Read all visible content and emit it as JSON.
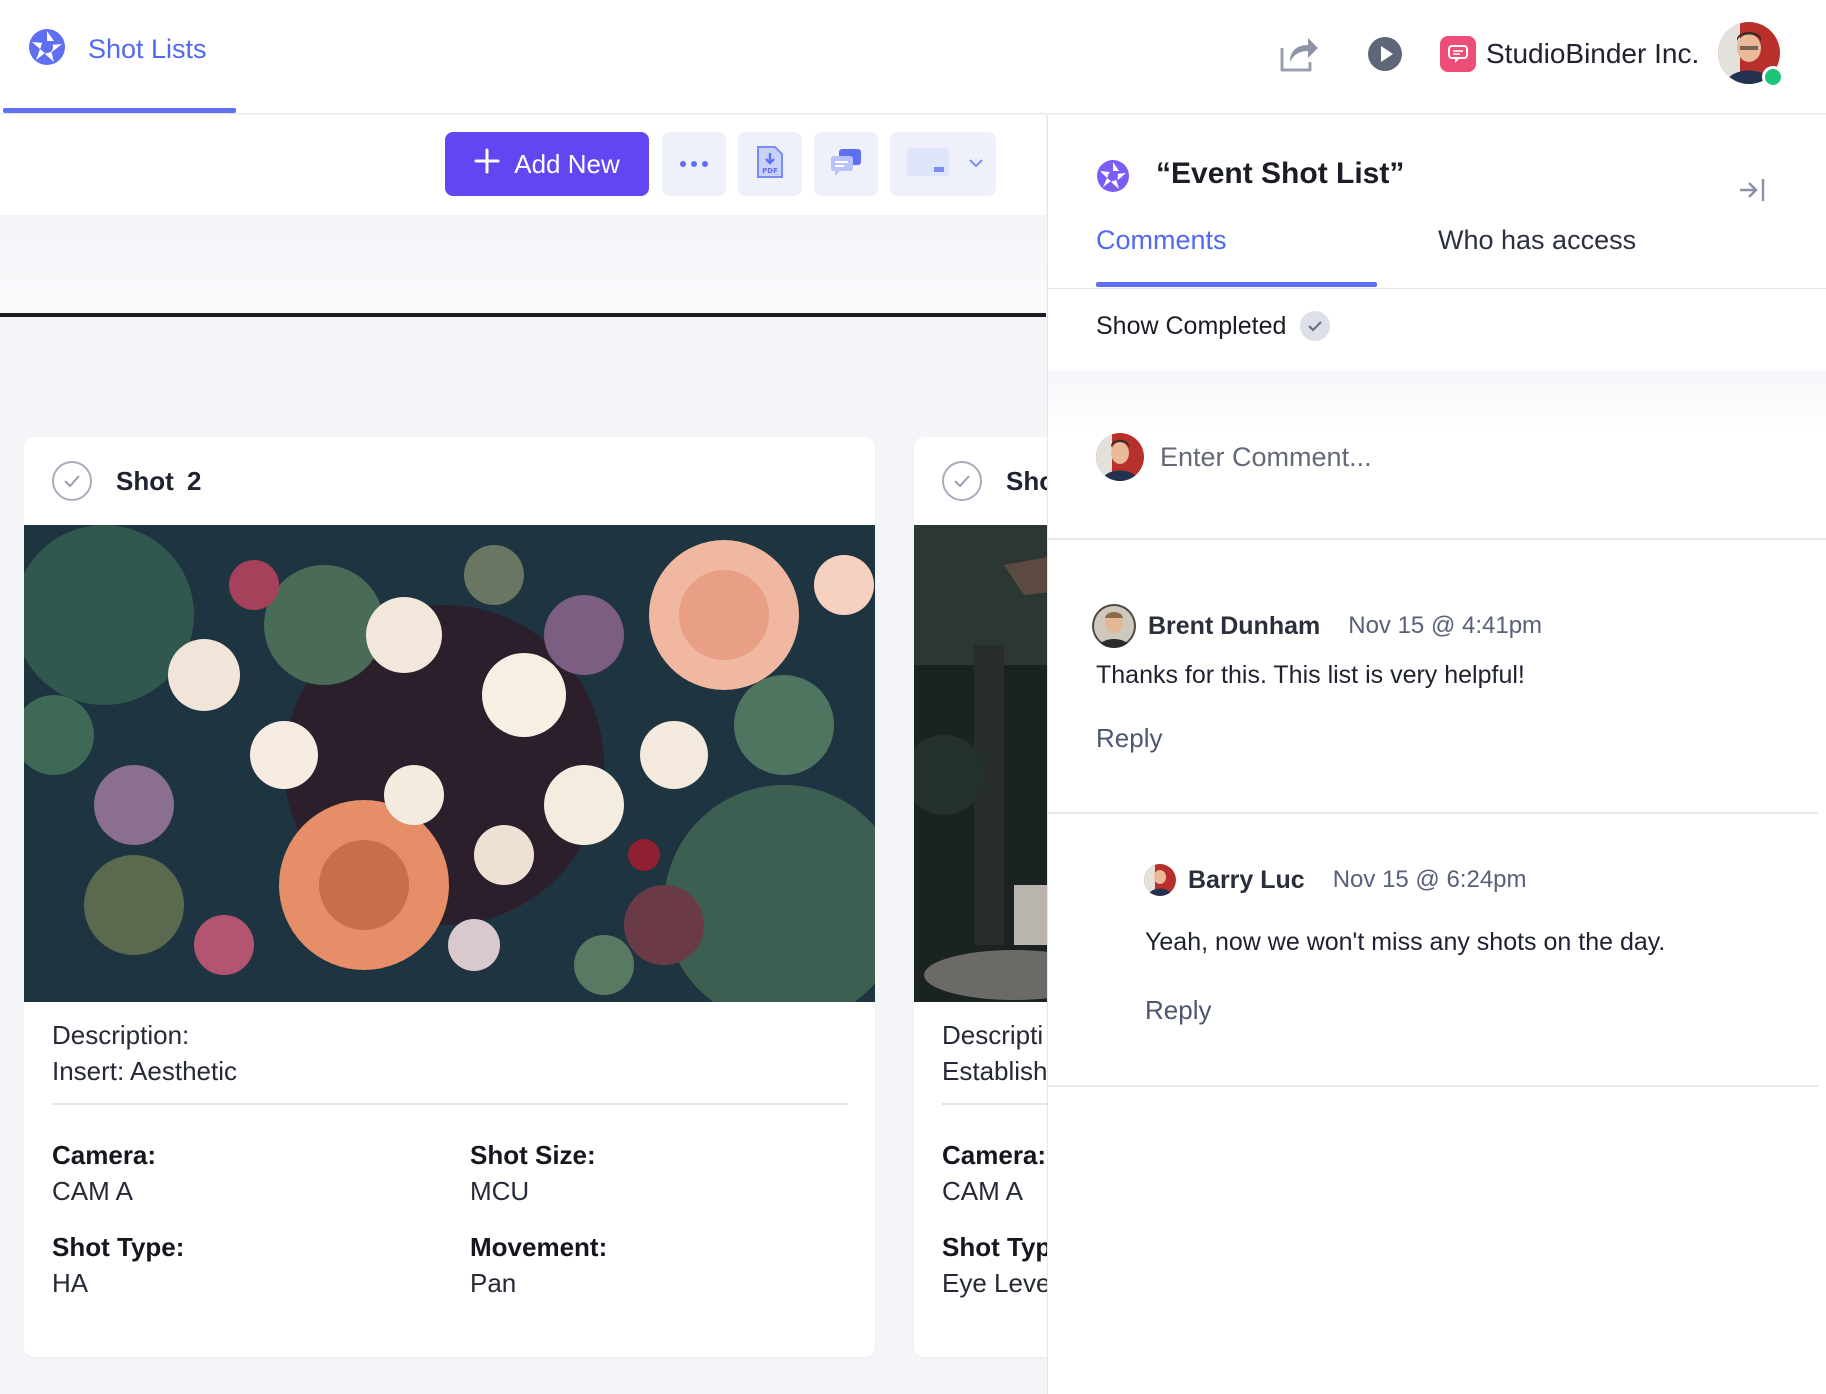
{
  "app": {
    "tab_label": "Shot Lists"
  },
  "header": {
    "company_name": "StudioBinder Inc."
  },
  "toolbar": {
    "add_new_label": "Add New"
  },
  "cards": [
    {
      "title": "Shot  2",
      "description_label": "Description:",
      "description_value": "Insert: Aesthetic",
      "camera_label": "Camera:",
      "camera_value": "CAM A",
      "shot_size_label": "Shot Size:",
      "shot_size_value": "MCU",
      "shot_type_label": "Shot Type:",
      "shot_type_value": "HA",
      "movement_label": "Movement:",
      "movement_value": "Pan"
    },
    {
      "title": "Sho",
      "description_label": "Descripti",
      "description_value": "Establish",
      "camera_label": "Camera:",
      "camera_value": "CAM A",
      "shot_type_label": "Shot Typ",
      "shot_type_value": "Eye Leve"
    }
  ],
  "panel": {
    "title": "“Event Shot List”",
    "tabs": [
      "Comments",
      "Who has access"
    ],
    "show_completed_label": "Show Completed",
    "comment_placeholder": "Enter Comment...",
    "comments": [
      {
        "author": "Brent Dunham",
        "time": "Nov 15 @ 4:41pm",
        "text": "Thanks for this. This list is very helpful!",
        "reply_label": "Reply"
      },
      {
        "author": "Barry Luc",
        "time": "Nov 15 @ 6:24pm",
        "text": "Yeah, now we won't miss any shots on the day.",
        "reply_label": "Reply"
      }
    ]
  },
  "colors": {
    "accent": "#6246f2",
    "link": "#5168f0",
    "online": "#1ec37a",
    "company_badge": "#ee4d77"
  }
}
